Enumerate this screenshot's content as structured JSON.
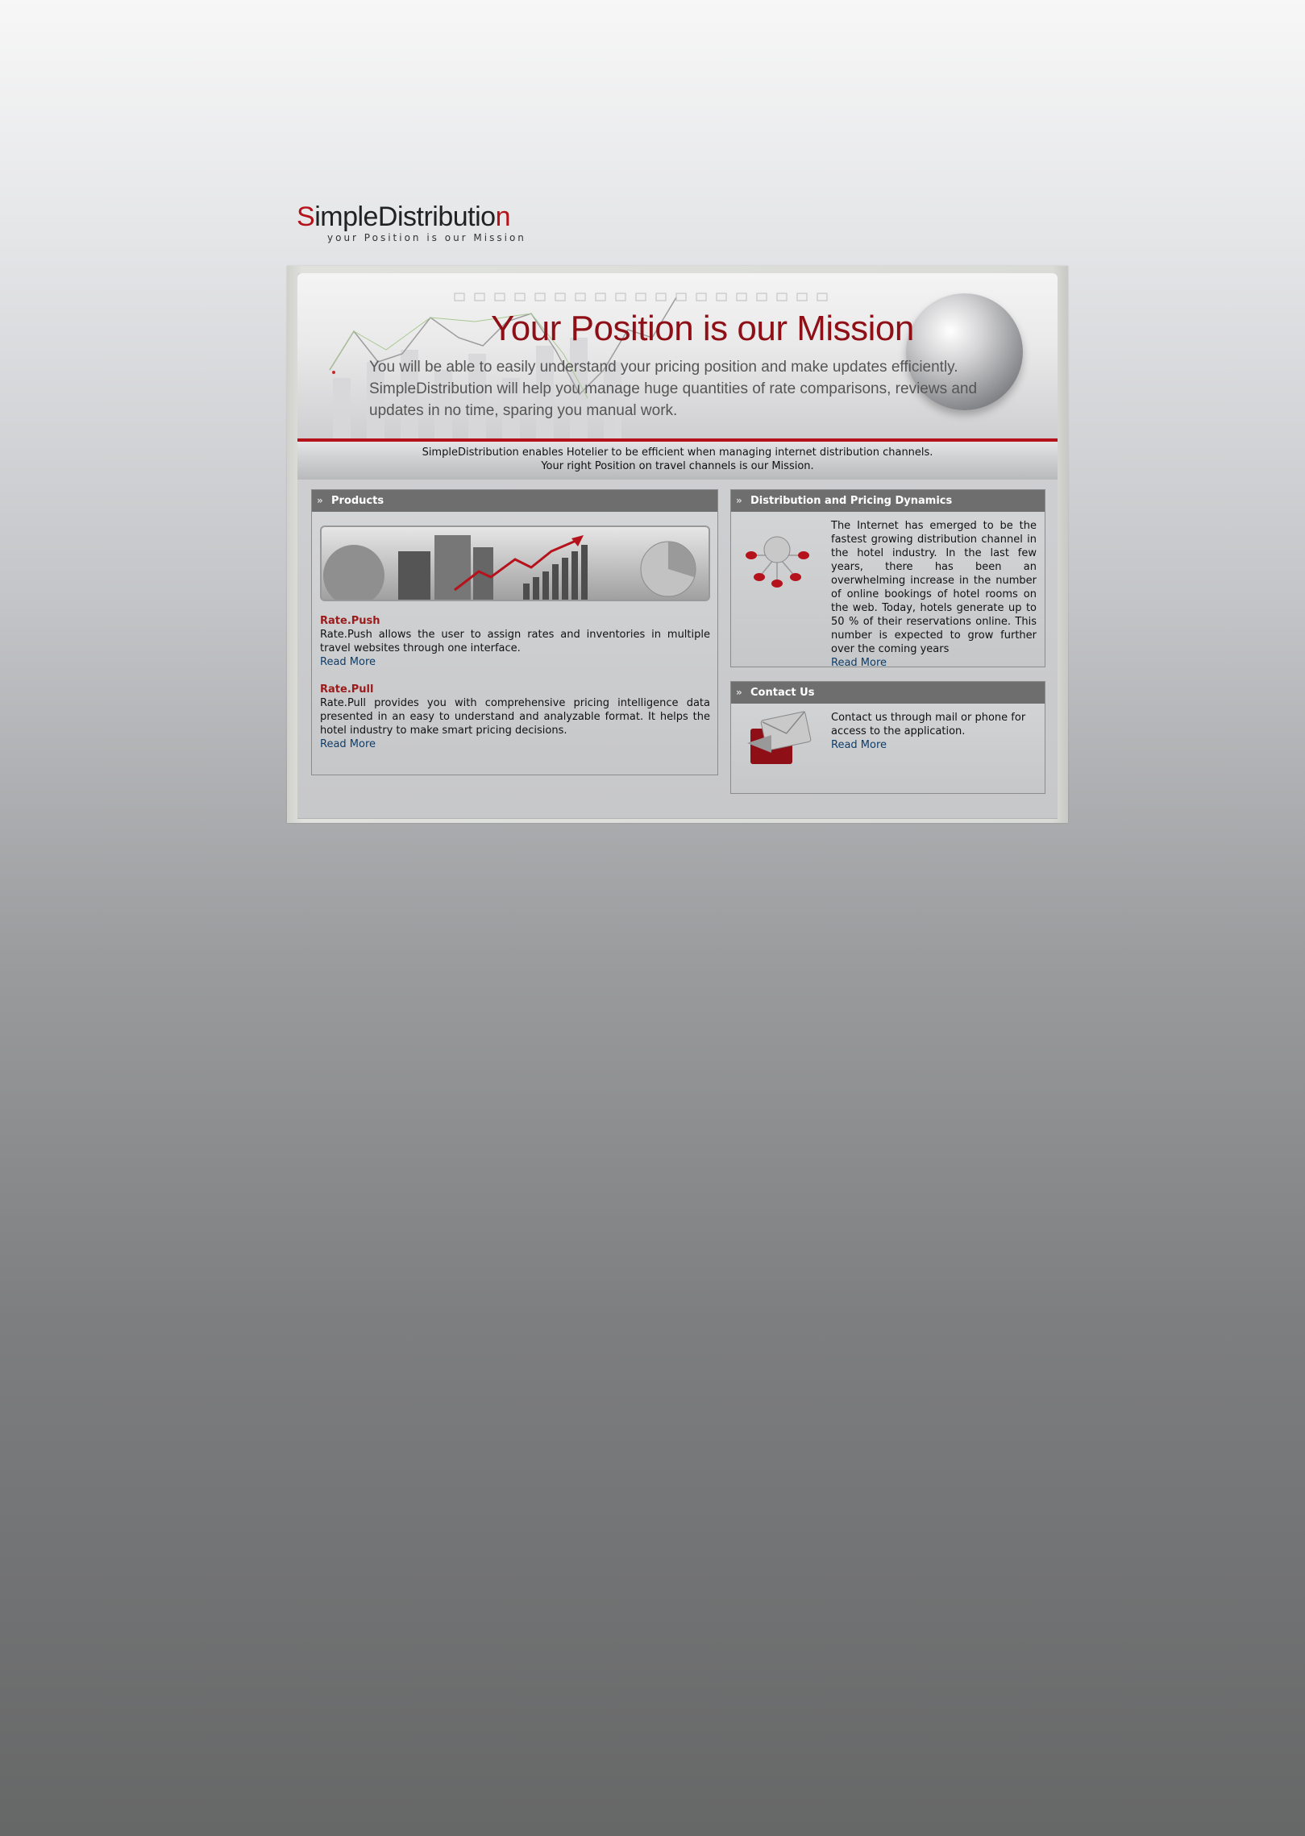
{
  "logo": {
    "first_letter": "S",
    "middle": "impleDistributio",
    "last_letter": "n",
    "tagline": "your Position is our Mission"
  },
  "banner": {
    "title": "Your Position is our Mission",
    "subtitle": "You will be able to easily understand your pricing position and make updates efficiently. SimpleDistribution will help you manage huge quantities of rate comparisons, reviews and updates in no time, sparing you manual work."
  },
  "strip": {
    "line1": "SimpleDistribution enables Hotelier to be efficient when managing internet distribution channels.",
    "line2": "Your right Position on travel channels is our Mission."
  },
  "products": {
    "heading": "Products",
    "items": [
      {
        "title": "Rate.Push",
        "description": "Rate.Push allows the user to assign rates and inventories in multiple travel websites through one interface.",
        "link": "Read More"
      },
      {
        "title": "Rate.Pull",
        "description": "Rate.Pull provides you with comprehensive pricing intelligence data presented in an easy to understand and analyzable format. It helps the hotel industry to make smart pricing decisions.",
        "link": "Read More"
      }
    ]
  },
  "distribution": {
    "heading": "Distribution and Pricing Dynamics",
    "text": "The Internet has emerged to be the fastest growing distribution channel in the hotel industry. In the last few years, there has been an overwhelming increase in the number of online bookings of hotel rooms on the web. Today, hotels generate up to 50 % of their reservations online. This number is expected to grow further over the coming years",
    "link": "Read More"
  },
  "contact": {
    "heading": "Contact Us",
    "text": "Contact us through mail or phone for access to the application.",
    "link": "Read More"
  },
  "colors": {
    "brand_red": "#b5121b",
    "title_red": "#8e0f16",
    "panel_header": "#6e6e6e",
    "link_blue": "#0d3d6b"
  },
  "icons": [
    "double-chevron-icon",
    "globe-icon",
    "network-globe-icon",
    "mail-envelope-icon"
  ]
}
